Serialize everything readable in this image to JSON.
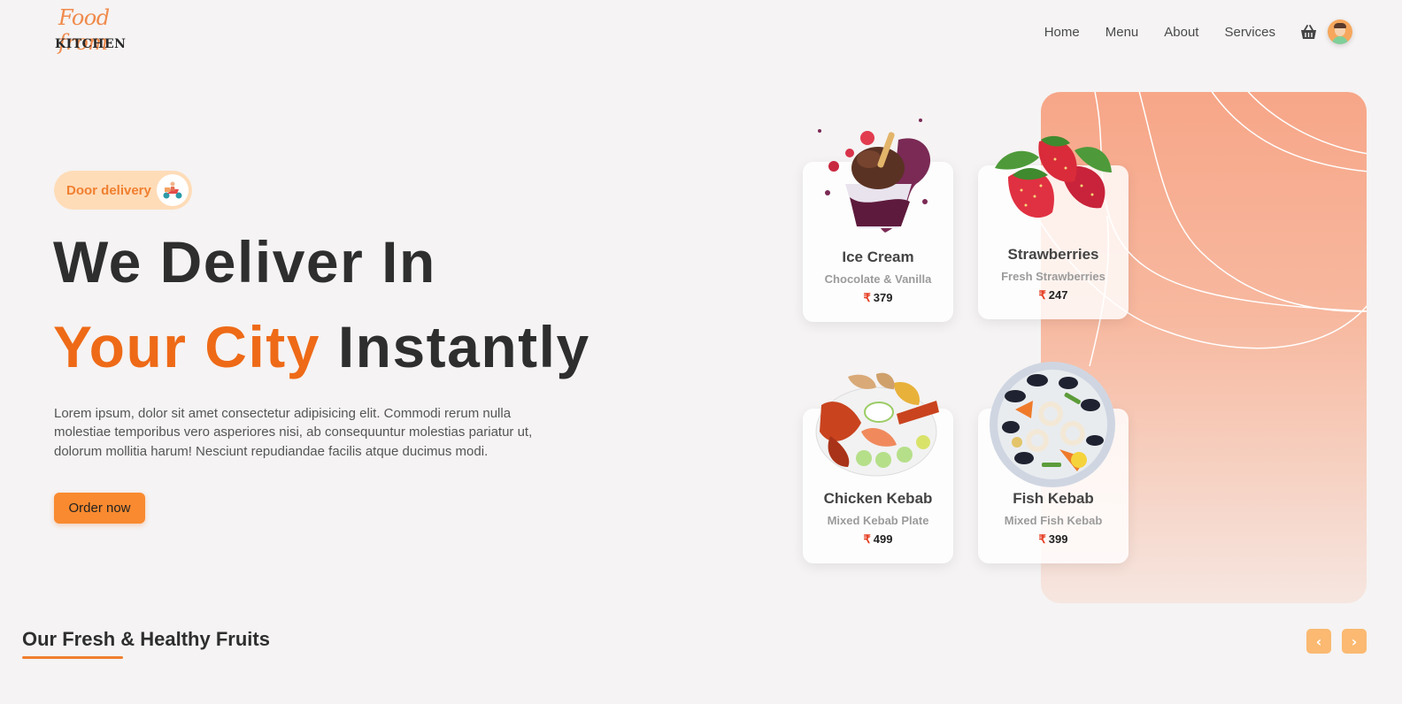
{
  "brand": {
    "line1": "Food from",
    "line2": "KITCHEN"
  },
  "nav": {
    "items": [
      "Home",
      "Menu",
      "About",
      "Services"
    ]
  },
  "hero": {
    "badge": "Door delivery",
    "title_line1": "We Deliver In",
    "title_highlight": "Your City",
    "title_rest": "Instantly",
    "description": "Lorem ipsum, dolor sit amet consectetur adipisicing elit. Commodi rerum nulla molestiae temporibus vero asperiores nisi, ab consequuntur molestias pariatur ut, dolorum mollitia harum! Nesciunt repudiandae facilis atque ducimus modi.",
    "cta": "Order now"
  },
  "cards": [
    {
      "name": "Ice Cream",
      "sub": "Chocolate & Vanilla",
      "currency": "₹",
      "price": "379"
    },
    {
      "name": "Strawberries",
      "sub": "Fresh Strawberries",
      "currency": "₹",
      "price": "247"
    },
    {
      "name": "Chicken Kebab",
      "sub": "Mixed Kebab Plate",
      "currency": "₹",
      "price": "499"
    },
    {
      "name": "Fish Kebab",
      "sub": "Mixed Fish Kebab",
      "currency": "₹",
      "price": "399"
    }
  ],
  "section": {
    "title": "Our Fresh & Healthy Fruits",
    "prev": "‹",
    "next": "›"
  },
  "colors": {
    "accent": "#ee6a17",
    "button": "#f98a2f",
    "badge_bg": "#ffdcb8",
    "panel": "#f7a688"
  }
}
